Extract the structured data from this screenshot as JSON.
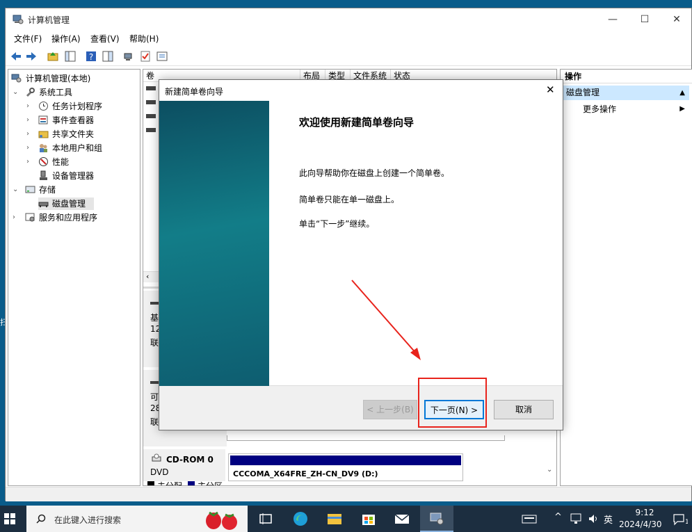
{
  "window": {
    "title": "计算机管理",
    "menu": [
      "文件(F)",
      "操作(A)",
      "查看(V)",
      "帮助(H)"
    ]
  },
  "tree": [
    {
      "label": "计算机管理(本地)",
      "level": 0
    },
    {
      "label": "系统工具",
      "level": 1,
      "expanded": true
    },
    {
      "label": "任务计划程序",
      "level": 2
    },
    {
      "label": "事件查看器",
      "level": 2
    },
    {
      "label": "共享文件夹",
      "level": 2
    },
    {
      "label": "本地用户和组",
      "level": 2
    },
    {
      "label": "性能",
      "level": 2
    },
    {
      "label": "设备管理器",
      "level": 2
    },
    {
      "label": "存储",
      "level": 1,
      "expanded": true
    },
    {
      "label": "磁盘管理",
      "level": 2,
      "selected": true
    },
    {
      "label": "服务和应用程序",
      "level": 1
    }
  ],
  "columns": [
    "卷",
    "布局",
    "类型",
    "文件系统",
    "状态"
  ],
  "disk_fragments": {
    "disk0": [
      "基",
      "12",
      "联"
    ],
    "disk1": [
      "可",
      "28",
      "联"
    ]
  },
  "cdrom": {
    "name": "CD-ROM 0",
    "type": "DVD",
    "volume": "CCCOMA_X64FRE_ZH-CN_DV9 (D:)"
  },
  "legend": [
    "未分配",
    "主分区"
  ],
  "actions": {
    "header": "操作",
    "section": "磁盘管理",
    "more": "更多操作"
  },
  "dialog": {
    "title": "新建简单卷向导",
    "heading": "欢迎使用新建简单卷向导",
    "line1": "此向导帮助你在磁盘上创建一个简单卷。",
    "line2": "简单卷只能在单一磁盘上。",
    "line3": "单击“下一步”继续。",
    "back": "< 上一步(B)",
    "next": "下一页(N) >",
    "cancel": "取消"
  },
  "taskbar": {
    "search_placeholder": "在此键入进行搜索",
    "time": "9:12",
    "date": "2024/4/30",
    "ime": "英"
  },
  "colors": {
    "annotation": "#e8231c",
    "selection": "#cce8ff",
    "primary_partition": "#000080"
  }
}
